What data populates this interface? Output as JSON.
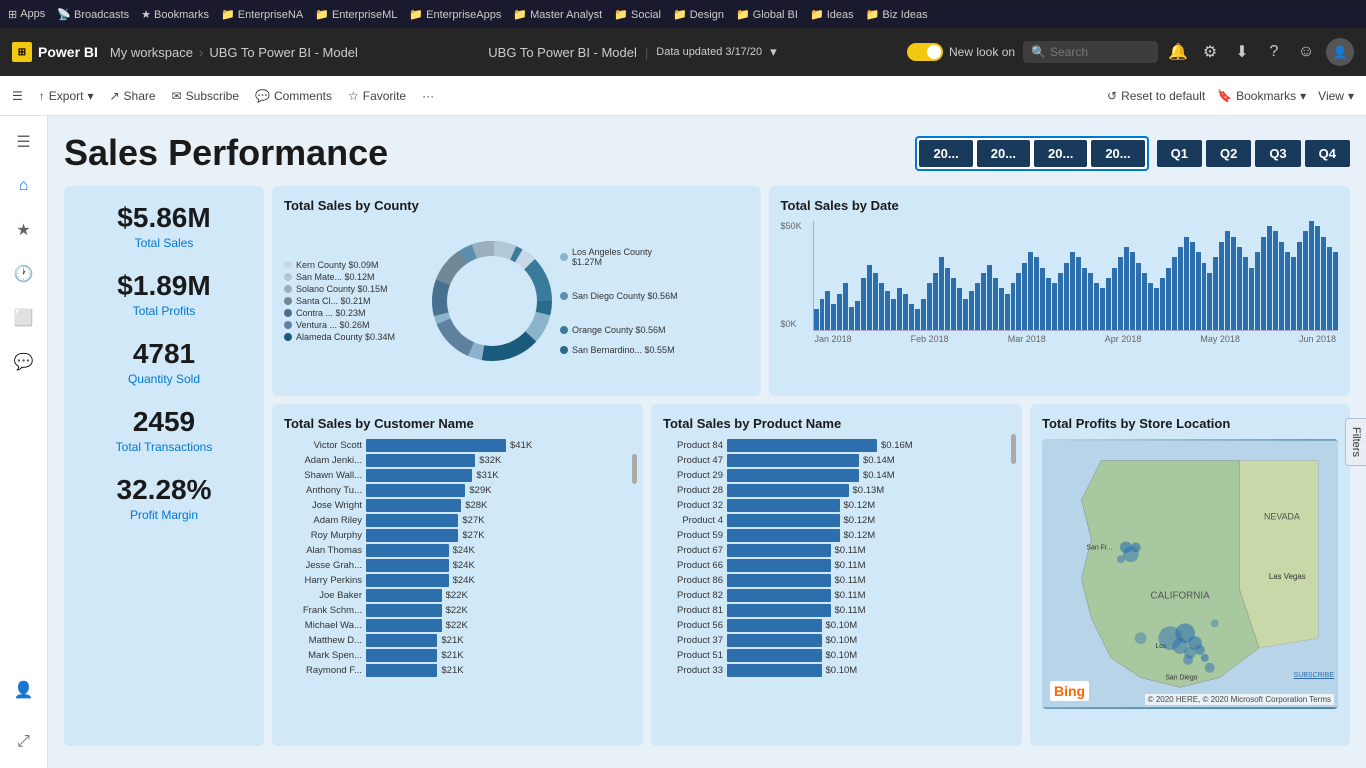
{
  "bookmarks": {
    "items": [
      {
        "label": "Apps",
        "icon": "⊞"
      },
      {
        "label": "Broadcasts",
        "icon": "📡"
      },
      {
        "label": "Bookmarks",
        "icon": "★"
      },
      {
        "label": "EnterpriseNA",
        "icon": "📁"
      },
      {
        "label": "EnterpriseML",
        "icon": "📁"
      },
      {
        "label": "EnterpriseApps",
        "icon": "📁"
      },
      {
        "label": "Master Analyst",
        "icon": "📁"
      },
      {
        "label": "Social",
        "icon": "📁"
      },
      {
        "label": "Design",
        "icon": "📁"
      },
      {
        "label": "Global BI",
        "icon": "📁"
      },
      {
        "label": "Ideas",
        "icon": "📁"
      },
      {
        "label": "Biz Ideas",
        "icon": "📁"
      }
    ]
  },
  "header": {
    "app_name": "Power BI",
    "workspace": "My workspace",
    "report": "UBG To Power BI - Model",
    "status": "Data updated 3/17/20",
    "new_look_label": "New look on",
    "search_placeholder": "Search"
  },
  "toolbar": {
    "export_label": "Export",
    "share_label": "Share",
    "subscribe_label": "Subscribe",
    "comments_label": "Comments",
    "favorite_label": "Favorite",
    "reset_label": "Reset to default",
    "bookmarks_label": "Bookmarks",
    "view_label": "View"
  },
  "dashboard": {
    "title": "Sales Performance",
    "year_buttons": [
      "20...",
      "20...",
      "20...",
      "20..."
    ],
    "quarter_buttons": [
      "Q1",
      "Q2",
      "Q3",
      "Q4"
    ]
  },
  "kpis": [
    {
      "value": "$5.86M",
      "label": "Total Sales"
    },
    {
      "value": "$1.89M",
      "label": "Total Profits"
    },
    {
      "value": "4781",
      "label": "Quantity Sold"
    },
    {
      "value": "2459",
      "label": "Total Transactions"
    },
    {
      "value": "32.28%",
      "label": "Profit Margin"
    }
  ],
  "donut_chart": {
    "title": "Total Sales by County",
    "segments": [
      {
        "label": "Los Angeles County",
        "value": "$1.27M",
        "color": "#8ab4cc",
        "pct": 28
      },
      {
        "label": "San Diego County",
        "value": "$0.56M",
        "color": "#5a8fb0",
        "pct": 12
      },
      {
        "label": "Orange County",
        "value": "$0.56M",
        "color": "#3a7a9a",
        "pct": 12
      },
      {
        "label": "San Bernardino...",
        "value": "$0.55M",
        "color": "#2a6a8a",
        "pct": 12
      },
      {
        "label": "Alameda County",
        "value": "$0.34M",
        "color": "#1a5a7a",
        "pct": 8
      },
      {
        "label": "Ventura ...",
        "value": "$0.26M",
        "color": "#6080a0",
        "pct": 6
      },
      {
        "label": "Contra ...",
        "value": "$0.23M",
        "color": "#4a7090",
        "pct": 5
      },
      {
        "label": "Santa Cl...",
        "value": "$0.21M",
        "color": "#708898",
        "pct": 5
      },
      {
        "label": "Solano County",
        "value": "$0.15M",
        "color": "#9ab0c0",
        "pct": 3
      },
      {
        "label": "San Mate...",
        "value": "$0.12M",
        "color": "#b0c8d8",
        "pct": 3
      },
      {
        "label": "Kern County",
        "value": "$0.09M",
        "color": "#c8d8e8",
        "pct": 2
      }
    ]
  },
  "timeseries": {
    "title": "Total Sales by Date",
    "y_labels": [
      "$50K",
      "$0K"
    ],
    "x_labels": [
      "Jan 2018",
      "Feb 2018",
      "Mar 2018",
      "Apr 2018",
      "May 2018",
      "Jun 2018"
    ],
    "bars": [
      8,
      12,
      15,
      10,
      14,
      18,
      9,
      11,
      20,
      25,
      22,
      18,
      15,
      12,
      16,
      14,
      10,
      8,
      12,
      18,
      22,
      28,
      24,
      20,
      16,
      12,
      15,
      18,
      22,
      25,
      20,
      16,
      14,
      18,
      22,
      26,
      30,
      28,
      24,
      20,
      18,
      22,
      26,
      30,
      28,
      24,
      22,
      18,
      16,
      20,
      24,
      28,
      32,
      30,
      26,
      22,
      18,
      16,
      20,
      24,
      28,
      32,
      36,
      34,
      30,
      26,
      22,
      28,
      34,
      38,
      36,
      32,
      28,
      24,
      30,
      36,
      40,
      38,
      34,
      30,
      28,
      34,
      38,
      42,
      40,
      36,
      32,
      30
    ]
  },
  "customer_sales": {
    "title": "Total Sales by Customer Name",
    "rows": [
      {
        "name": "Victor Scott",
        "value": "$41K",
        "pct": 100
      },
      {
        "name": "Adam Jenki...",
        "value": "$32K",
        "pct": 78
      },
      {
        "name": "Shawn Wall...",
        "value": "$31K",
        "pct": 76
      },
      {
        "name": "Anthony Tu...",
        "value": "$29K",
        "pct": 71
      },
      {
        "name": "Jose Wright",
        "value": "$28K",
        "pct": 68
      },
      {
        "name": "Adam Riley",
        "value": "$27K",
        "pct": 66
      },
      {
        "name": "Roy Murphy",
        "value": "$27K",
        "pct": 66
      },
      {
        "name": "Alan Thomas",
        "value": "$24K",
        "pct": 59
      },
      {
        "name": "Jesse Grah...",
        "value": "$24K",
        "pct": 59
      },
      {
        "name": "Harry Perkins",
        "value": "$24K",
        "pct": 59
      },
      {
        "name": "Joe Baker",
        "value": "$22K",
        "pct": 54
      },
      {
        "name": "Frank Schm...",
        "value": "$22K",
        "pct": 54
      },
      {
        "name": "Michael Wa...",
        "value": "$22K",
        "pct": 54
      },
      {
        "name": "Matthew D...",
        "value": "$21K",
        "pct": 51
      },
      {
        "name": "Mark Spen...",
        "value": "$21K",
        "pct": 51
      },
      {
        "name": "Raymond F...",
        "value": "$21K",
        "pct": 51
      }
    ]
  },
  "product_sales": {
    "title": "Total Sales by Product Name",
    "rows": [
      {
        "name": "Product 84",
        "value": "$0.16M",
        "pct": 100
      },
      {
        "name": "Product 47",
        "value": "$0.14M",
        "pct": 88
      },
      {
        "name": "Product 29",
        "value": "$0.14M",
        "pct": 88
      },
      {
        "name": "Product 28",
        "value": "$0.13M",
        "pct": 81
      },
      {
        "name": "Product 32",
        "value": "$0.12M",
        "pct": 75
      },
      {
        "name": "Product 4",
        "value": "$0.12M",
        "pct": 75
      },
      {
        "name": "Product 59",
        "value": "$0.12M",
        "pct": 75
      },
      {
        "name": "Product 67",
        "value": "$0.11M",
        "pct": 69
      },
      {
        "name": "Product 66",
        "value": "$0.11M",
        "pct": 69
      },
      {
        "name": "Product 86",
        "value": "$0.11M",
        "pct": 69
      },
      {
        "name": "Product 82",
        "value": "$0.11M",
        "pct": 69
      },
      {
        "name": "Product 81",
        "value": "$0.11M",
        "pct": 69
      },
      {
        "name": "Product 56",
        "value": "$0.10M",
        "pct": 63
      },
      {
        "name": "Product 37",
        "value": "$0.10M",
        "pct": 63
      },
      {
        "name": "Product 51",
        "value": "$0.10M",
        "pct": 63
      },
      {
        "name": "Product 33",
        "value": "$0.10M",
        "pct": 63
      }
    ]
  },
  "map": {
    "title": "Total Profits by Store Location",
    "bing_label": "Bing",
    "credit": "© 2020 HERE, © 2020 Microsoft Corporation Terms"
  },
  "sidebar": {
    "items": [
      {
        "icon": "☰",
        "name": "menu"
      },
      {
        "icon": "⌂",
        "name": "home"
      },
      {
        "icon": "★",
        "name": "favorites"
      },
      {
        "icon": "🕐",
        "name": "recent"
      },
      {
        "icon": "📱",
        "name": "apps"
      },
      {
        "icon": "💬",
        "name": "messages"
      },
      {
        "icon": "👤",
        "name": "profile"
      }
    ]
  },
  "filters": {
    "label": "Filters"
  }
}
